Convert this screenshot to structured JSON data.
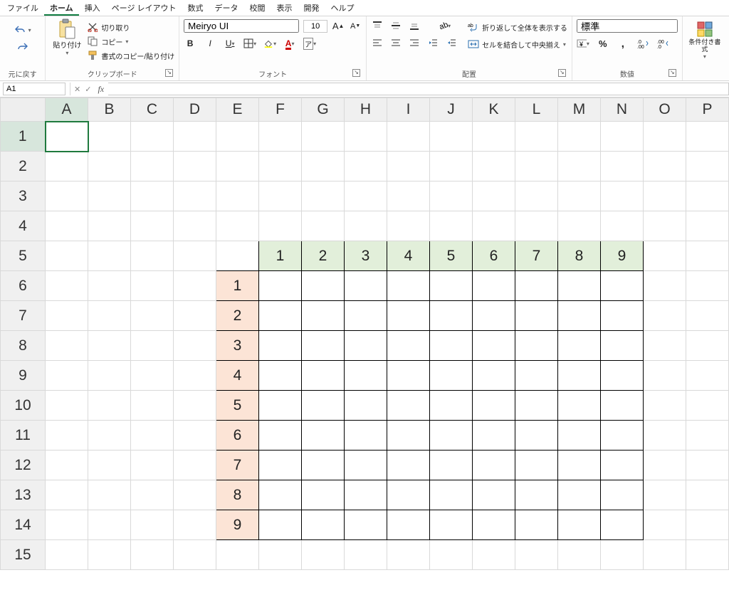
{
  "menu": {
    "items": [
      "ファイル",
      "ホーム",
      "挿入",
      "ページ レイアウト",
      "数式",
      "データ",
      "校閲",
      "表示",
      "開発",
      "ヘルプ"
    ],
    "active_index": 1
  },
  "ribbon": {
    "undo": {
      "caption": "元に戻す"
    },
    "clipboard": {
      "paste": "貼り付け",
      "cut": "切り取り",
      "copy": "コピー",
      "format_painter": "書式のコピー/貼り付け",
      "caption": "クリップボード"
    },
    "font": {
      "name": "Meiryo UI",
      "size": "10",
      "caption": "フォント"
    },
    "alignment": {
      "wrap": "折り返して全体を表示する",
      "merge": "セルを結合して中央揃え",
      "caption": "配置"
    },
    "number": {
      "format": "標準",
      "caption": "数値"
    },
    "styles": {
      "cond": "条件付き書式"
    }
  },
  "namebox": "A1",
  "formula": "",
  "columns": [
    "A",
    "B",
    "C",
    "D",
    "E",
    "F",
    "G",
    "H",
    "I",
    "J",
    "K",
    "L",
    "M",
    "N",
    "O",
    "P"
  ],
  "rows": [
    "1",
    "2",
    "3",
    "4",
    "5",
    "6",
    "7",
    "8",
    "9",
    "10",
    "11",
    "12",
    "13",
    "14",
    "15"
  ],
  "selected_cell": {
    "col": "A",
    "row": "1"
  },
  "data_table": {
    "top_left_col": "E",
    "top_left_row": "5",
    "col_headers": [
      "1",
      "2",
      "3",
      "4",
      "5",
      "6",
      "7",
      "8",
      "9"
    ],
    "row_headers": [
      "1",
      "2",
      "3",
      "4",
      "5",
      "6",
      "7",
      "8",
      "9"
    ]
  }
}
